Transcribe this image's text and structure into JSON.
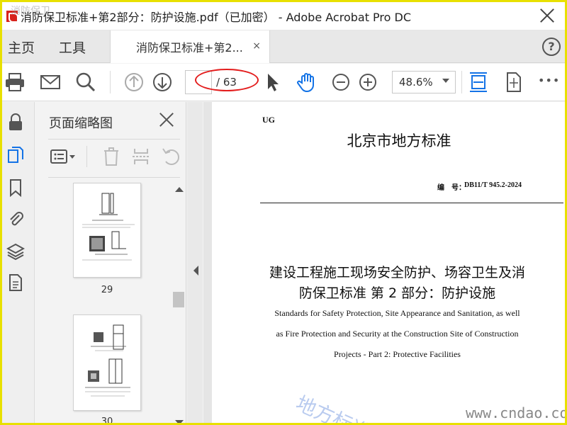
{
  "window": {
    "title": "消防保卫标准+第2部分：防护设施.pdf（已加密） - Adobe Acrobat Pro DC"
  },
  "menu": {
    "home": "主页",
    "tools": "工具"
  },
  "tab": {
    "label": "消防保卫标准+第2...",
    "close": "×"
  },
  "help": {
    "label": "?"
  },
  "toolbar": {
    "page_current": "",
    "page_total": "/ 63",
    "zoom": "48.6%",
    "more": "•••"
  },
  "thumbnails": {
    "title": "页面缩略图",
    "pages": [
      {
        "number": "29"
      },
      {
        "number": "30"
      }
    ]
  },
  "document": {
    "prefix": "UG",
    "standard_type": "北京市地方标准",
    "code_label": "编　号：",
    "code": "DB11/T 945.2-2024",
    "title_line1": "建设工程施工现场安全防护、场容卫生及消",
    "title_line2": "防保卫标准  第 2 部分：防护设施",
    "en_line1": "Standards for Safety Protection, Site Appearance and Sanitation, as well",
    "en_line2": "as Fire Protection and Security at the Construction Site of Construction",
    "en_line3": "Projects - Part 2: Protective Facilities"
  },
  "watermarks": {
    "corner": "消防保卫",
    "diagonal": "地方标准",
    "url": "www.cndao.com"
  },
  "colors": {
    "border": "#e8e000",
    "accent_blue": "#1473e6",
    "annotation_red": "#e31d1d",
    "acrobat_red": "#d8231c"
  }
}
